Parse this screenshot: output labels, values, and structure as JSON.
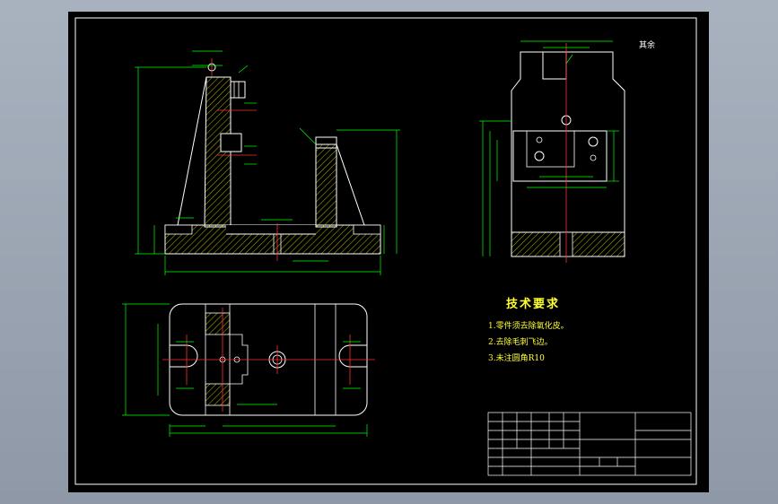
{
  "drawing": {
    "roughness_note": "其余",
    "tech_requirements": {
      "title": "技术要求",
      "items": [
        "1.零件须去除氧化皮。",
        "2.去除毛刺飞边。",
        "3.未注圆角R10"
      ]
    }
  },
  "colors": {
    "frame": "#ffffff",
    "part_outline": "#ffffff",
    "dimension": "#00ff00",
    "centerline": "#ff0000",
    "hatch": "#ffff00",
    "text": "#ffff33",
    "background": "#000000",
    "desktop": "#9ea6b3"
  }
}
